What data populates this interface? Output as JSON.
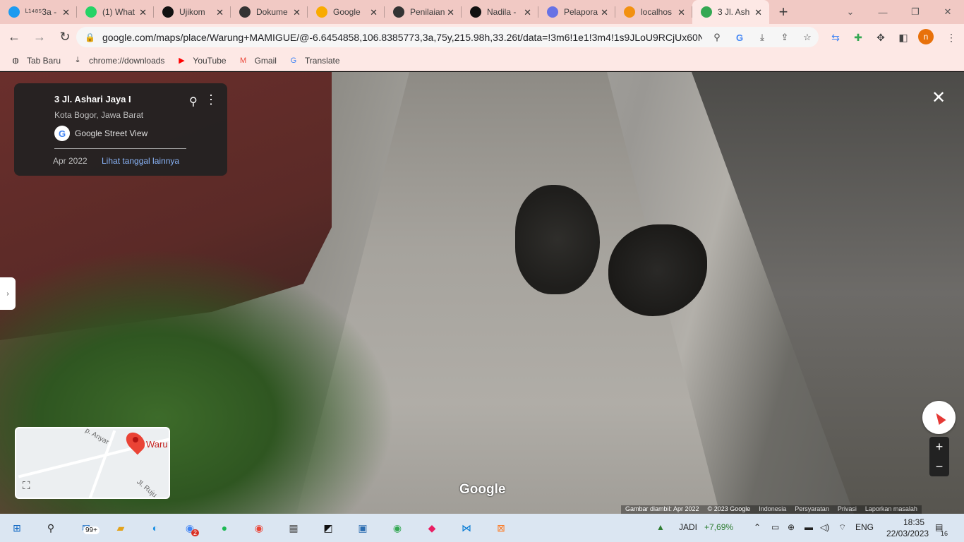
{
  "browser": {
    "tabs": [
      {
        "label": "ᴸ¹⁴⁸⁵3a -",
        "icon": "twitter-icon",
        "color": "#1d9bf0"
      },
      {
        "label": "(1) What",
        "icon": "whatsapp-icon",
        "color": "#25d366"
      },
      {
        "label": "Ujikom",
        "icon": "notion-icon",
        "color": "#111111"
      },
      {
        "label": "Dokume",
        "icon": "globe-icon",
        "color": "#333333"
      },
      {
        "label": "Google",
        "icon": "google-classroom-icon",
        "color": "#f9ab00"
      },
      {
        "label": "Penilaian",
        "icon": "globe-icon",
        "color": "#333333"
      },
      {
        "label": "Nadila -",
        "icon": "notion-icon",
        "color": "#111111"
      },
      {
        "label": "Pelapora",
        "icon": "stripe-icon",
        "color": "#6772e5"
      },
      {
        "label": "localhos",
        "icon": "pma-icon",
        "color": "#f29111"
      },
      {
        "label": "3 Jl. Ash",
        "icon": "google-maps-icon",
        "color": "#34a853",
        "active": true
      }
    ],
    "url": "google.com/maps/place/Warung+MAMIGUE/@-6.6454858,106.8385773,3a,75y,215.98h,33.26t/data=!3m6!1e1!3m4!1s9JLoU9RCjUx60NI...",
    "profile_initial": "n",
    "bookmarks": [
      {
        "label": "Tab Baru",
        "icon": "globe-icon"
      },
      {
        "label": "chrome://downloads",
        "icon": "download-icon"
      },
      {
        "label": "YouTube",
        "icon": "youtube-icon"
      },
      {
        "label": "Gmail",
        "icon": "gmail-icon"
      },
      {
        "label": "Translate",
        "icon": "translate-icon"
      }
    ]
  },
  "streetview": {
    "address": "3 Jl. Ashari Jaya I",
    "city": "Kota Bogor, Jawa Barat",
    "source": "Google Street View",
    "date": "Apr 2022",
    "more_dates": "Lihat tanggal lainnya",
    "google_logo": "Google",
    "minimap": {
      "place_label": "Waru",
      "street1": "p. Anyar",
      "street2": "Jl. Ruju"
    },
    "attribution": [
      "Gambar diambil: Apr 2022",
      "© 2023 Google",
      "Indonesia",
      "Persyaratan",
      "Privasi",
      "Laporkan masalah"
    ]
  },
  "taskbar": {
    "mail_badge": "99+",
    "chrome_badge": "2",
    "stock_name": "JADI",
    "stock_change": "+7,69%",
    "language": "ENG",
    "time": "18:35",
    "date": "22/03/2023",
    "notification_count": "16"
  }
}
